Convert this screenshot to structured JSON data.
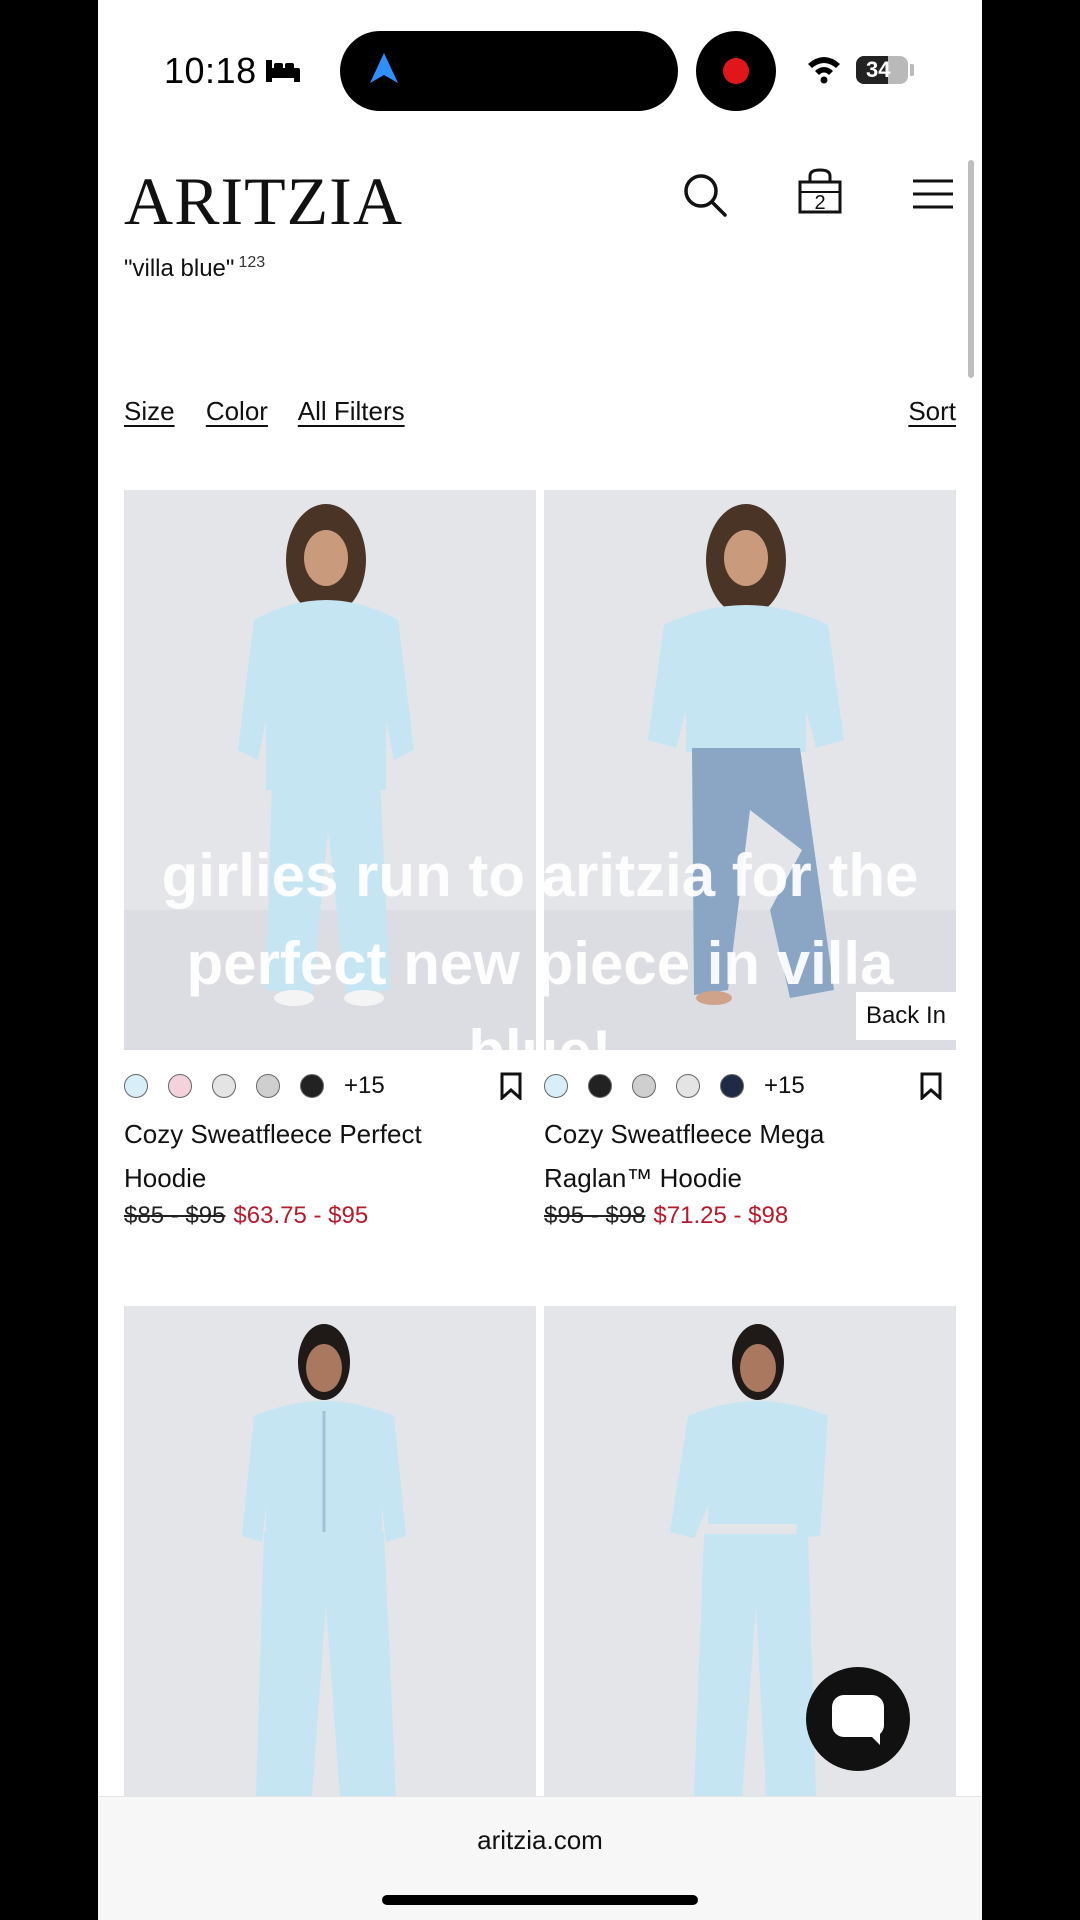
{
  "status_bar": {
    "time": "10:18",
    "battery": "34"
  },
  "header": {
    "logo": "ARITZIA",
    "cart_count": "2"
  },
  "search_query": "\"villa blue\"",
  "result_count": "123",
  "filters": {
    "size": "Size",
    "color": "Color",
    "all_filters": "All Filters",
    "sort": "Sort"
  },
  "overlay_caption": {
    "line1": "girlies run to aritzia for the",
    "line2": "perfect new piece in villa",
    "line3": "blue!"
  },
  "products": [
    {
      "name_line1": "Cozy Sweatfleece Perfect",
      "name_line2": "Hoodie",
      "old_price": "$85 - $95",
      "new_price": "$63.75 - $95",
      "more_colors": "+15",
      "swatches": [
        "#d8eef8",
        "#f3d2dc",
        "#e4e4e4",
        "#cfcfcf",
        "#222222"
      ],
      "badge": ""
    },
    {
      "name_line1": "Cozy Sweatfleece Mega",
      "name_line2": "Raglan™ Hoodie",
      "old_price": "$95 - $98",
      "new_price": "$71.25 - $98",
      "more_colors": "+15",
      "swatches": [
        "#d8eef8",
        "#222222",
        "#cfcfcf",
        "#e4e4e4",
        "#1f2a44"
      ],
      "badge": "Back In"
    }
  ],
  "browser": {
    "url": "aritzia.com"
  },
  "colors": {
    "sale_red": "#b8192b",
    "product_blue": "#c9e6f3"
  }
}
